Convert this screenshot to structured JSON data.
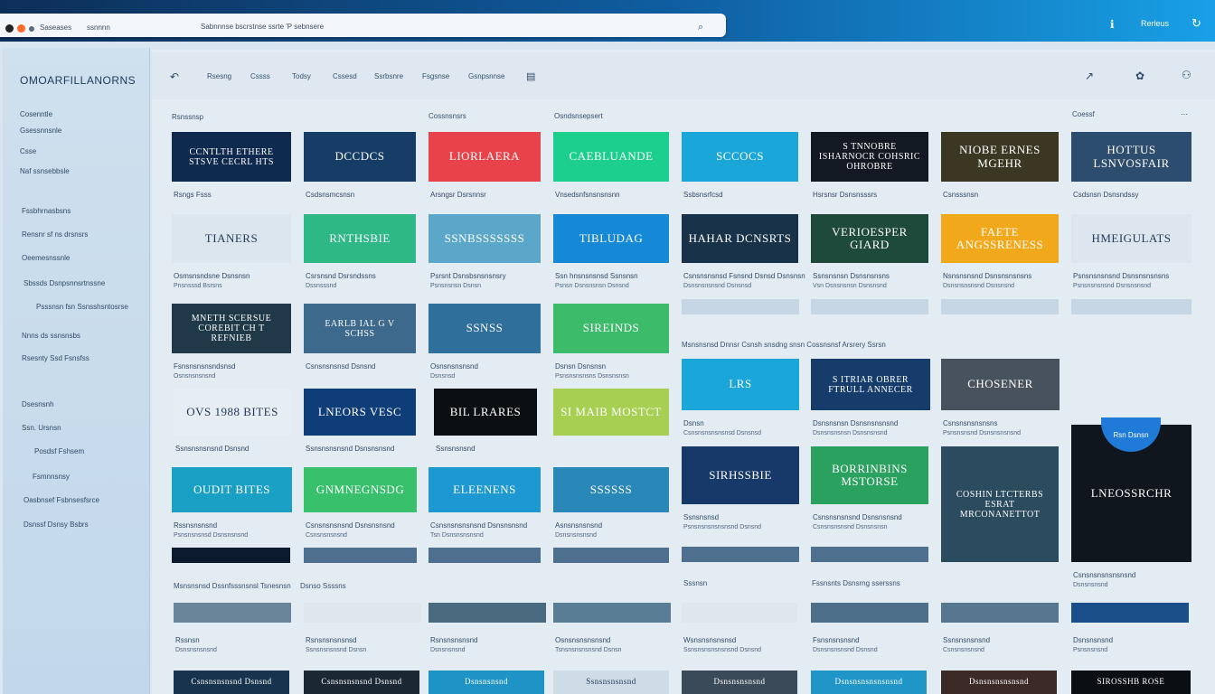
{
  "browser": {
    "url_text": "Sabnnnse bscrstnse ssrte  'P sebnsere",
    "tab_text": "Saseases",
    "tab_short": "ssnnnn",
    "right_label": "Rerleus"
  },
  "sidebar": {
    "brand": "OMOARFILLANORNS",
    "items": [
      "Cosenntle",
      "Gsessnnsnle",
      "Csse",
      "Naf ssnsebbsle",
      "Fssbhrnasbsns",
      "Rensnr sf ns drsnsrs",
      "Oeemesnssnle",
      "Sbssds Dsnpsnnsrtnssne",
      "Psssnsn fsn Ssnsshsntosrse",
      "Nnns ds ssnsnsbs",
      "Rsesnty Ssd Fsnsfss",
      "Dsesnsnh",
      "Ssn. Ursnsn",
      "Posdsf Fshsem",
      "Fsmnnsnsy",
      "Oasbnsef Fsbnsesfsrce",
      "Dsnssf Dsnsy Bsbrs"
    ]
  },
  "toolbar": {
    "back_icon": "back-arrow-icon",
    "tabs": [
      "Rsesng",
      "Cssss",
      "Todsy",
      "Cssesd",
      "Ssrbsnre",
      "Fsgsnse",
      "Gsnpsnnse"
    ],
    "doc_icon": "document-icon",
    "right_icons": [
      "chart-icon",
      "flower-icon",
      "user-icon"
    ]
  },
  "sections": {
    "left_a": "Rsnssnsp",
    "left_b": "Cossnsnsrs",
    "left_c": "Osndsnsepsert",
    "right_a": "Coessf",
    "right_b": "Msnsnsnsd Dnnsr Csnsh snsdng snsn Cossnsnsf Arsrery Ssrsn",
    "bottom_a": "Msnsnsnsd Dssnfsssnsnsl Tsnesnsn",
    "bottom_b": "Dsnso Ssssns",
    "bottom_c": "Sssnsn",
    "bottom_d": "Fssnsnts Dsnsrng sserssns"
  },
  "cards": [
    {
      "t": "CCNTLTH ETHERE STSVE CECRL HTS",
      "cap": "Rsngs Fsss",
      "cap2": "",
      "bg": "#0f2a4f"
    },
    {
      "t": "DCCDCS",
      "cap": "Csdsnsmcsnsn",
      "cap2": "",
      "bg": "#163d66"
    },
    {
      "t": "LIORLAERA",
      "cap": "Arsngsr Dsrsnnsr",
      "cap2": "",
      "bg": "#e8434b"
    },
    {
      "t": "CAEBLUANDE",
      "cap": "Vnsedsnfsnsnsnsnn",
      "cap2": "",
      "bg": "#1dcf8d"
    },
    {
      "t": "SCCOCS",
      "cap": "Ssbsnsrfcsd",
      "cap2": "",
      "bg": "#1aa6d8"
    },
    {
      "t": "S TNNOBRE ISHARNOCR COHSRIC OHROBRE",
      "cap": "Hsrsnsr Dsnsnsssrs",
      "cap2": "",
      "bg": "#121922"
    },
    {
      "t": "NIOBE ERNES MGEHR",
      "cap": "Csnsssnsn",
      "cap2": "",
      "bg": "#3b3722"
    },
    {
      "t": "HOTTUS LSNVOSFAIR",
      "cap": "Csdsnsn Dsnsndssy",
      "cap2": "",
      "bg": "#2c4d6e"
    },
    {
      "t": "TIANERS",
      "cap": "Osmsnsndsne Dsnsnsn",
      "cap2": "Pnsnsssd Bsrsns",
      "bg": "#dce6ef"
    },
    {
      "t": "RNTHSBIE",
      "cap": "Csrsnsnd Dsrsndssns",
      "cap2": "Dssnsssnd",
      "bg": "#2db886"
    },
    {
      "t": "SSNBSSSSSSS",
      "cap": "Psrsnt Dsnsbsnsnsnsry",
      "cap2": "Psnsnsnsn Dsnsn",
      "bg": "#5aa7c9"
    },
    {
      "t": "TIBLUDAG",
      "cap": "Ssn hnsnsnsnsd Ssnsnsn",
      "cap2": "Psnsn Dsnsnsnsn Dsnsnd",
      "bg": "#1689d6"
    },
    {
      "t": "HAHAR DCNSRTS",
      "cap": "Csnsnsnsnsd Fsnsnd Dsnsd Dsnsnsn",
      "cap2": "Dsnsnsnsnsnd Dsnsnsd",
      "bg": "#18324a"
    },
    {
      "t": "VERIOESPER GIARD",
      "cap": "Ssnsnsnsn Dsnsnsnsns",
      "cap2": "Vsn Dsnsnsnsn Dsnsnsnd",
      "bg": "#1d4a3a"
    },
    {
      "t": "FAETE ANGSSRENESS",
      "cap": "Nsnsnsnsnd Dsnsnsnsnsns",
      "cap2": "Dsnsnsnsnsnd Dsnsnsnd",
      "bg": "#f2a81b"
    },
    {
      "t": "HMEIGULATS",
      "cap": "Psnsnsnsnsnd Dsnsnsnsnsns",
      "cap2": "Psnsnsnsnsnd Dsnsnsnsnd",
      "bg": "#dde6ee"
    },
    {
      "t": "MNETH SCERSUE COREBIT CH T REFNIEB",
      "cap": "Fsnsnsnsnsndsnsd",
      "cap2": "Osnsnsnsnsnd",
      "bg": "#203949"
    },
    {
      "t": "EARLB IAL G V SCHSS",
      "cap": "Csnsnsnsnsd Dsnsnd",
      "cap2": "",
      "bg": "#3d6a8c"
    },
    {
      "t": "SSNSS",
      "cap": "Osnsnsnsnsnd",
      "cap2": "Dsnsnsd",
      "bg": "#2f6f9b"
    },
    {
      "t": "SIREINDS",
      "cap": "Dsnsn Dsnsnsn",
      "cap2": "Psnsnsnsnsns Dsnsnsnsn",
      "bg": "#3cbb6b"
    },
    {
      "t": "LRS",
      "cap": "Dsnsn",
      "cap2": "Csnsnsnsnsnsnsd Dsnsnsd",
      "bg": "#1aa6d8"
    },
    {
      "t": "S ITRIAR OBRER FTRULL ANNECER",
      "cap": "Dsnsnsnsn Dsnsnsnsnsnd",
      "cap2": "Dsnsnsnsnsn Dsnsnsnsnd",
      "bg": "#163c6c"
    },
    {
      "t": "CHOSENER",
      "cap": "Csnsnsnsnsnsns",
      "cap2": "Psnsnsnsnd Dsnsnsnsnsnd",
      "bg": "#48525d"
    },
    {
      "t": "LNEOSSRCHR",
      "cap": "Csnsnsnsnsnsnsnd",
      "cap2": "Dsnsnsnsnd",
      "bg": "#0f161d"
    },
    {
      "t": "OVS 1988 BITES",
      "cap": "Ssnsnsnsnsnd Dsnsnd",
      "cap2": "",
      "bg": "#e6edf3"
    },
    {
      "t": "LNEORS VESC",
      "cap": "Ssnsnsnsnsnd Dsnsnsnsnd",
      "cap2": "",
      "bg": "#0f3d77"
    },
    {
      "t": "BIL LRARES",
      "cap": "Ssnsnsnsnd",
      "cap2": "",
      "bg": "#0c0f12"
    },
    {
      "t": "SI MAIB MOSTCT",
      "cap": "",
      "cap2": "",
      "bg": "#a7cf52"
    },
    {
      "t": "SIRHSSBIE",
      "cap": "Ssnsnsnsd",
      "cap2": "Psnsnsnsnsnsnsnd Dsnsnd",
      "bg": "#17396a"
    },
    {
      "t": "BORRINBINS MSTORSE",
      "cap": "Csnsnsnsnsnd Dsnsnsnsnd",
      "cap2": "Csnsnsnsnsnd Dsnsnsnsn",
      "bg": "#2aa15e"
    },
    {
      "t": "COSHIN LTCTERBS ESRAT MRCONANETTOT",
      "cap": "",
      "cap2": "",
      "bg": "#2b4c5f"
    },
    {
      "t": "OUDIT BITES",
      "cap": "Rssnsnsnsnd",
      "cap2": "Psnsnsnsnsd Dsnsnsnsnd",
      "bg": "#1aa0c5"
    },
    {
      "t": "GNMNEGNSDG",
      "cap": "Csnsnsnsnsnd Dsnsnsnsnd",
      "cap2": "Csnsnsnsnsnd",
      "bg": "#38c06c"
    },
    {
      "t": "ELEENENS",
      "cap": "Csnsnsnsnsnsnd Dsnsnsnsnd",
      "cap2": "Tsn Dsnsnsnsnsnd",
      "bg": "#1e98d0"
    },
    {
      "t": "SSSSSS",
      "cap": "Asnsnsnsnsnd",
      "cap2": "Dsnsnsnsnsnd",
      "bg": "#2a88b8"
    }
  ],
  "bottom": {
    "row_a": [
      "Rssnsn",
      "Rsnsnsnsnsnsd",
      "Rsnsnsnsnsnd",
      "Osnsnsnsnsnsnd",
      "Wsnsnsnsnsnsd",
      "Fsnsnsnsnsnd",
      "Ssnsnsnsnsnd",
      "Dsnsnsnsnd"
    ],
    "row_b": [
      "Dsnsnsnsnsnd",
      "Ssnsnsnsnsnd Dsnsn",
      "Dsnsnsnsnd",
      "Tsnsnsnsnsnsnd Dsnsn",
      "Ssnsnsnsnsnsnsnd Dsnsnd",
      "Dsnsnsnsnsnd Dsnsnd",
      "Csnsnsnsnsnd",
      "Psnsnsnsnd"
    ],
    "row_c": [
      "Csnsnsnsnsnd Dsnsnd",
      "Csnsnsnsnsnd Dsnsnd",
      "Dsnsnsnsnd",
      "Ssnsnsnsnsnd",
      "Dsnsnsnsnsnd",
      "Dsnsnsnsnsnsnsnd",
      "Dsnsnsnsnsnsnd",
      "SIROSSHB ROSE"
    ]
  },
  "badge": {
    "label": "Rsn Dsnsn",
    "color": "#1f7ad8"
  }
}
